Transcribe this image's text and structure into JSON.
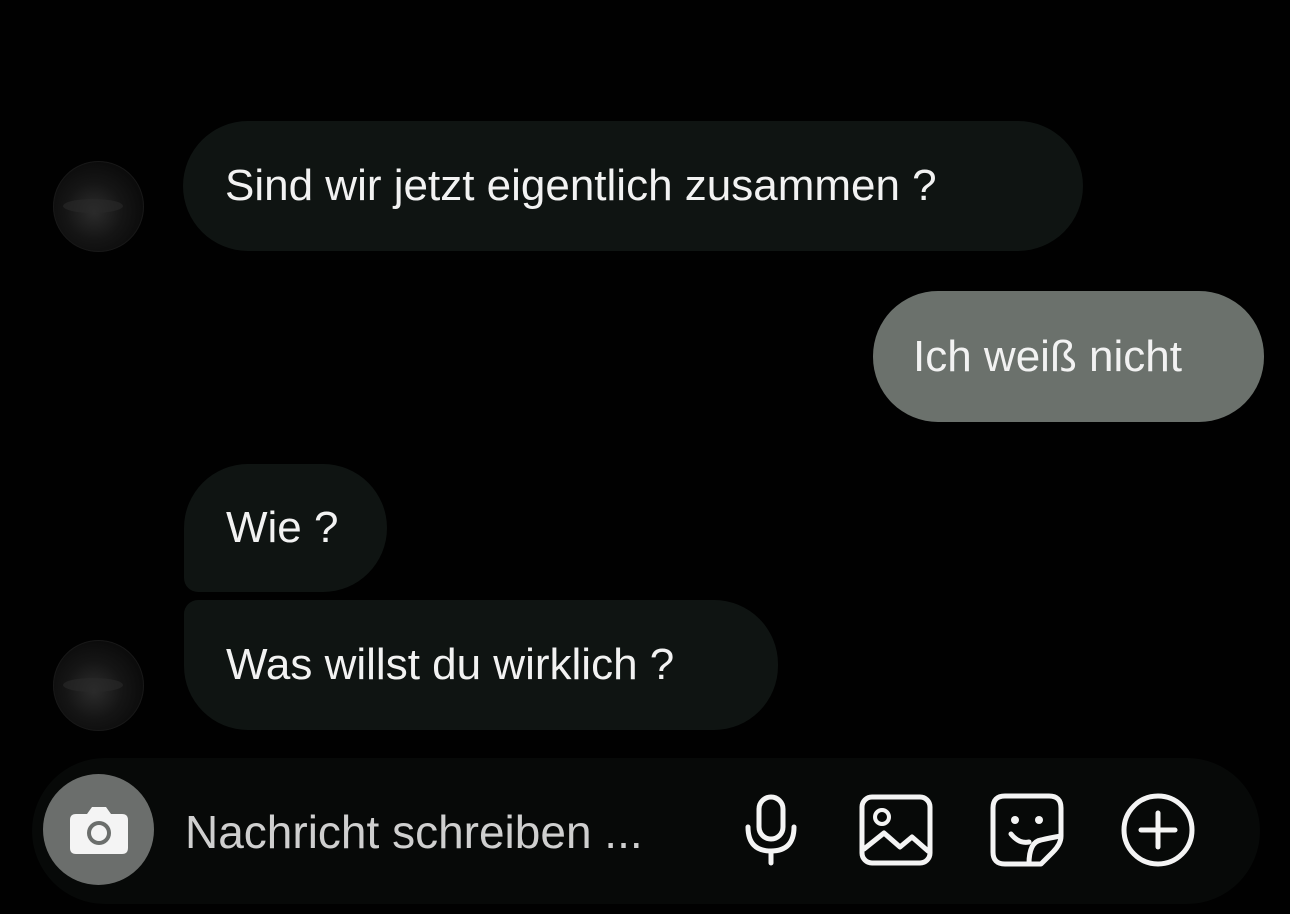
{
  "messages": [
    {
      "direction": "incoming",
      "text": "Sind wir jetzt eigentlich zusammen ?"
    },
    {
      "direction": "outgoing",
      "text": "Ich weiß nicht"
    },
    {
      "direction": "incoming",
      "text": "Wie ?"
    },
    {
      "direction": "incoming",
      "text": "Was willst du wirklich ?"
    }
  ],
  "composer": {
    "placeholder": "Nachricht schreiben ...",
    "icons": [
      "camera-icon",
      "microphone-icon",
      "gallery-icon",
      "sticker-icon",
      "plus-icon"
    ]
  },
  "colors": {
    "background": "#010101",
    "incoming_bubble": "#0f1412",
    "outgoing_bubble": "#6b716c",
    "camera_button": "#6b6e6c",
    "text": "#f2f2f2"
  }
}
